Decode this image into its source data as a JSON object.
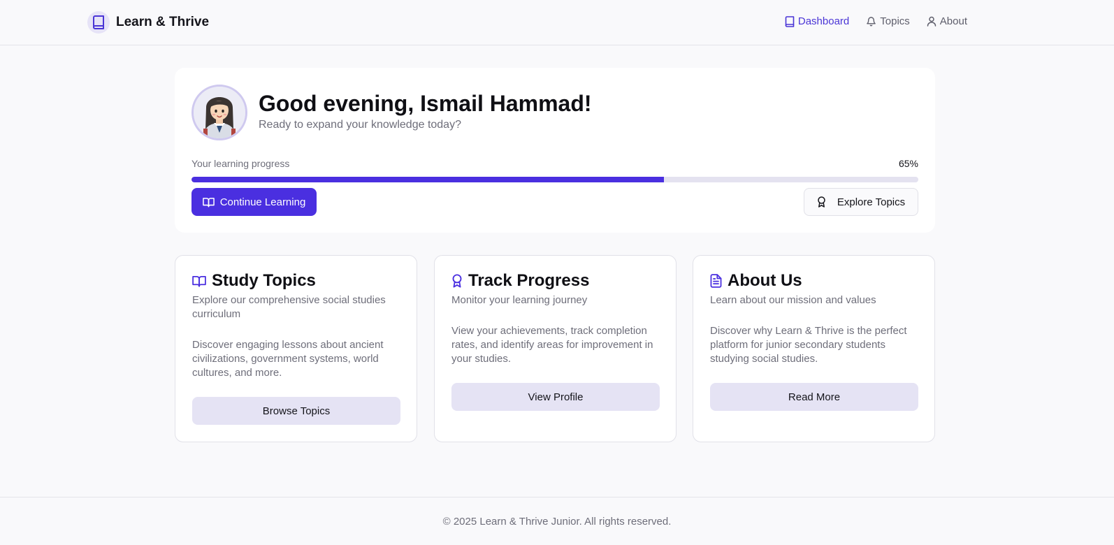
{
  "header": {
    "brand": "Learn & Thrive",
    "nav": [
      {
        "label": "Dashboard",
        "icon": "book-icon",
        "active": true
      },
      {
        "label": "Topics",
        "icon": "bell-icon",
        "active": false
      },
      {
        "label": "About",
        "icon": "user-icon",
        "active": false
      }
    ]
  },
  "welcome": {
    "greeting": "Good evening, Ismail Hammad!",
    "subtitle": "Ready to expand your knowledge today?",
    "progress_label": "Your learning progress",
    "progress_text": "65%",
    "progress_value": 0.65,
    "continue_label": "Continue Learning",
    "explore_label": "Explore Topics"
  },
  "cards": [
    {
      "title": "Study Topics",
      "icon": "open-book-icon",
      "subtitle": "Explore our comprehensive social studies curriculum",
      "body": "Discover engaging lessons about ancient civilizations, government systems, world cultures, and more.",
      "button": "Browse Topics"
    },
    {
      "title": "Track Progress",
      "icon": "award-icon",
      "subtitle": "Monitor your learning journey",
      "body": "View your achievements, track completion rates, and identify areas for improvement in your studies.",
      "button": "View Profile"
    },
    {
      "title": "About Us",
      "icon": "document-icon",
      "subtitle": "Learn about our mission and values",
      "body": "Discover why Learn & Thrive is the perfect platform for junior secondary students studying social studies.",
      "button": "Read More"
    }
  ],
  "footer": {
    "text": "© 2025 Learn & Thrive Junior. All rights reserved."
  },
  "colors": {
    "accent": "#4a2fe0",
    "accent_text": "#4a35d6",
    "card_button_bg": "#e5e3f4",
    "page_bg": "#f9f9fb"
  }
}
